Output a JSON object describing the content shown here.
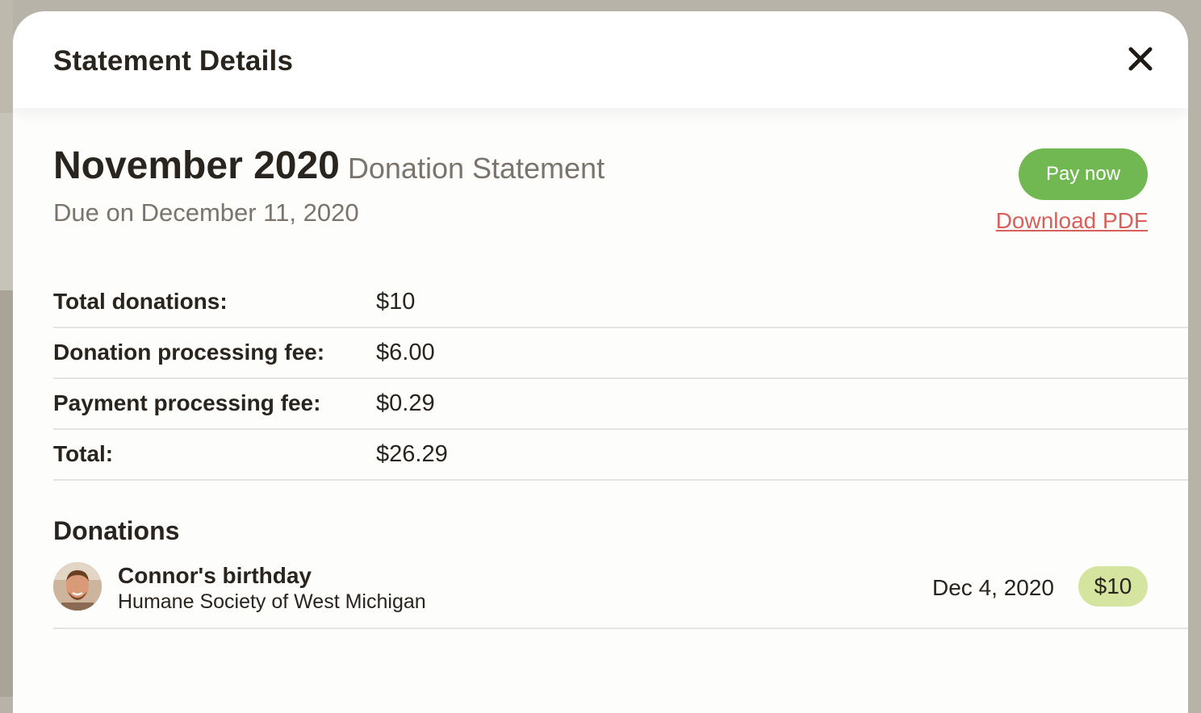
{
  "modal": {
    "title": "Statement Details",
    "close_icon": "close-icon"
  },
  "statement": {
    "month": "November 2020",
    "type": "Donation Statement",
    "due": "Due on December 11, 2020",
    "pay_label": "Pay now",
    "download_label": "Download PDF"
  },
  "summary": [
    {
      "label": "Total donations:",
      "value": "$10"
    },
    {
      "label": "Donation processing fee:",
      "value": "$6.00"
    },
    {
      "label": "Payment processing fee:",
      "value": "$0.29"
    },
    {
      "label": "Total:",
      "value": "$26.29"
    }
  ],
  "donations": {
    "title": "Donations",
    "items": [
      {
        "title": "Connor's birthday",
        "organization": "Humane Society of West Michigan",
        "date": "Dec 4, 2020",
        "amount": "$10",
        "avatar_icon": "person-avatar"
      }
    ]
  },
  "colors": {
    "primary_button": "#72b852",
    "link": "#d9605a",
    "amount_badge": "#d5e5a0",
    "text": "#2a241e",
    "muted_text": "#7a746c"
  }
}
